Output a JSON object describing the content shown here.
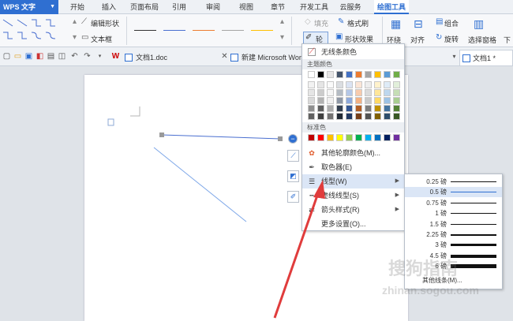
{
  "app": {
    "name": "WPS 文字"
  },
  "menu_tabs": [
    "开始",
    "插入",
    "页面布局",
    "引用",
    "审阅",
    "视图",
    "章节",
    "开发工具",
    "云服务",
    "绘图工具"
  ],
  "ribbon": {
    "edit_shape": "编辑形状",
    "text_box": "文本框",
    "fill": "填充",
    "format_brush": "格式刷",
    "outline": "轮廓",
    "shape_effects": "形状效果",
    "wrap": "环绕",
    "align": "对齐",
    "rotate": "旋转",
    "group": "组合",
    "select_pane": "选择窗格",
    "bottom": "下"
  },
  "doc_tabs": [
    {
      "label": "文档1.doc",
      "active": false
    },
    {
      "label": "新建 Microsoft Word",
      "active": false
    },
    {
      "label": "文档1 *",
      "active": true
    }
  ],
  "dropdown": {
    "no_line_color": "无线条颜色",
    "theme_colors": "主题颜色",
    "standard_colors": "标准色",
    "more_colors": "其他轮廓颜色(M)...",
    "eyedropper": "取色器(E)",
    "line_type": "线型(W)",
    "dash_type": "虚线线型(S)",
    "arrow_style": "箭头样式(R)",
    "more_settings": "更多设置(O)..."
  },
  "theme_top_row": [
    "#ffffff",
    "#000000",
    "#e7e6e6",
    "#44546a",
    "#4472c4",
    "#ed7d31",
    "#a5a5a5",
    "#ffc000",
    "#5b9bd5",
    "#70ad47"
  ],
  "standard_colors": [
    "#c00000",
    "#ff0000",
    "#ffc000",
    "#ffff00",
    "#92d050",
    "#00b050",
    "#00b0f0",
    "#0070c0",
    "#002060",
    "#7030a0"
  ],
  "line_weights": [
    {
      "label": "0.25 磅",
      "value": 0.25
    },
    {
      "label": "0.5 磅",
      "value": 0.5
    },
    {
      "label": "0.75 磅",
      "value": 0.75
    },
    {
      "label": "1 磅",
      "value": 1
    },
    {
      "label": "1.5 磅",
      "value": 1.5
    },
    {
      "label": "2.25 磅",
      "value": 2.25
    },
    {
      "label": "3 磅",
      "value": 3
    },
    {
      "label": "4.5 磅",
      "value": 4.5
    },
    {
      "label": "6 磅",
      "value": 6
    }
  ],
  "selected_weight_index": 1,
  "more_lines": "其他线条(M)...",
  "watermark": {
    "text1": "搜狗指南",
    "text2": "zhinan.sogou.com"
  },
  "colors": {
    "accent": "#2f6fd1",
    "highlight": "#dbe6f6",
    "arrow": "#e03c3c",
    "shape_line": "#4a6fd0"
  }
}
